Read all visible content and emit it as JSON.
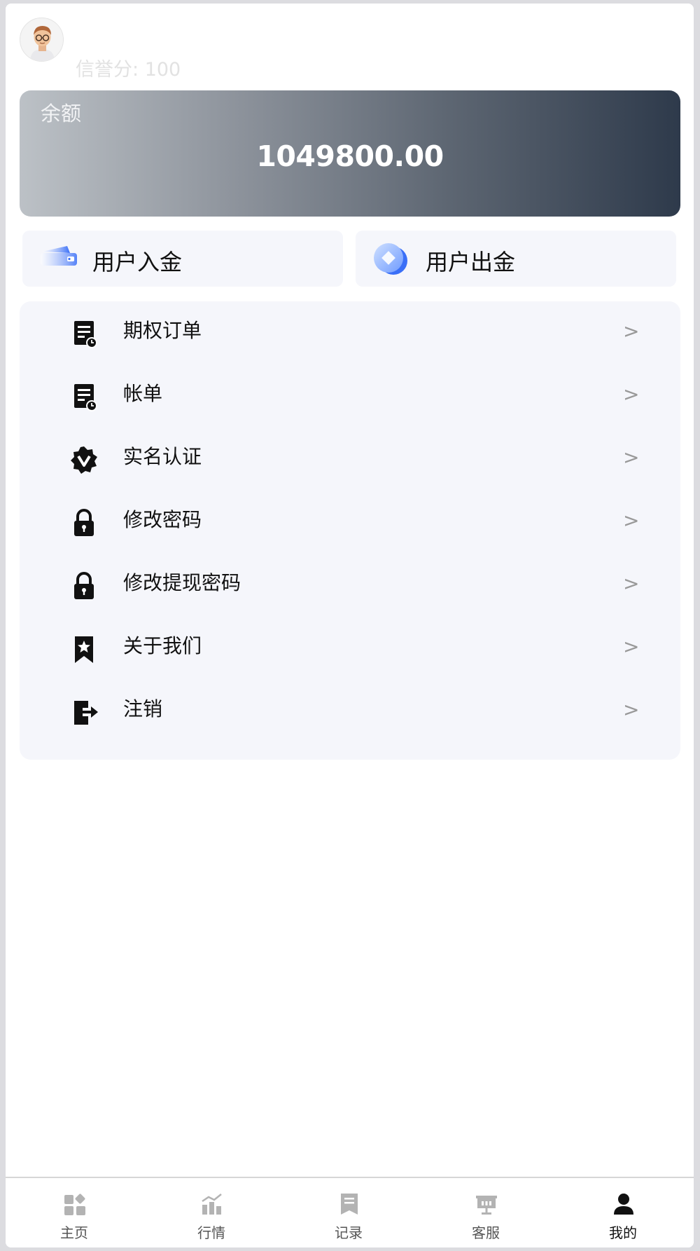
{
  "header": {
    "credit_label": "信誉分:",
    "credit_value": "100"
  },
  "balance": {
    "label": "余额",
    "amount": "1049800.00"
  },
  "actions": {
    "deposit_label": "用户入金",
    "withdraw_label": "用户出金"
  },
  "menu": {
    "items": [
      {
        "label": "期权订单",
        "icon": "document-clock-icon"
      },
      {
        "label": "帐单",
        "icon": "document-clock-icon"
      },
      {
        "label": "实名认证",
        "icon": "verified-badge-icon"
      },
      {
        "label": "修改密码",
        "icon": "lock-icon"
      },
      {
        "label": "修改提现密码",
        "icon": "lock-icon"
      },
      {
        "label": "关于我们",
        "icon": "bookmark-star-icon"
      },
      {
        "label": "注销",
        "icon": "logout-icon"
      }
    ],
    "arrow": ">"
  },
  "tabbar": {
    "tabs": [
      {
        "label": "主页",
        "icon": "home-grid-icon"
      },
      {
        "label": "行情",
        "icon": "market-chart-icon"
      },
      {
        "label": "记录",
        "icon": "record-doc-icon"
      },
      {
        "label": "客服",
        "icon": "service-board-icon"
      },
      {
        "label": "我的",
        "icon": "user-icon"
      }
    ],
    "active_index": 4
  },
  "colors": {
    "card_gradient_start": "#bcc1c6",
    "card_gradient_end": "#2e3a4b",
    "panel_bg": "#f5f6fb",
    "accent_blue": "#3a6ff7"
  }
}
